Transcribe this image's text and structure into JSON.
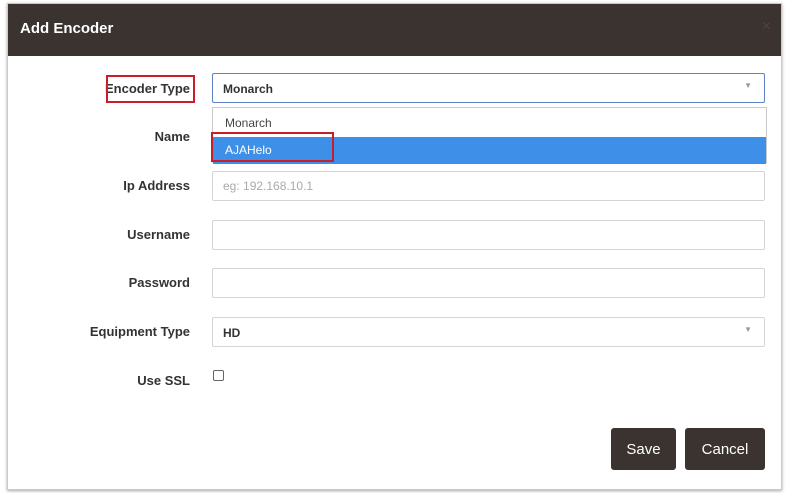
{
  "dialog": {
    "title": "Add Encoder",
    "close_label": "×"
  },
  "form": {
    "encoder_type": {
      "label": "Encoder Type",
      "value": "Monarch",
      "options": [
        "Monarch",
        "AJAHelo"
      ],
      "highlighted_option": "AJAHelo"
    },
    "name": {
      "label": "Name",
      "value": ""
    },
    "ip_address": {
      "label": "Ip Address",
      "placeholder": "eg: 192.168.10.1",
      "value": ""
    },
    "username": {
      "label": "Username",
      "value": ""
    },
    "password": {
      "label": "Password",
      "value": ""
    },
    "equipment_type": {
      "label": "Equipment Type",
      "value": "HD"
    },
    "use_ssl": {
      "label": "Use SSL",
      "checked": false
    }
  },
  "footer": {
    "save_label": "Save",
    "cancel_label": "Cancel"
  },
  "colors": {
    "header_bg": "#3a3330",
    "highlight": "#3d8fe8",
    "annotation_red": "#c81e2c"
  }
}
